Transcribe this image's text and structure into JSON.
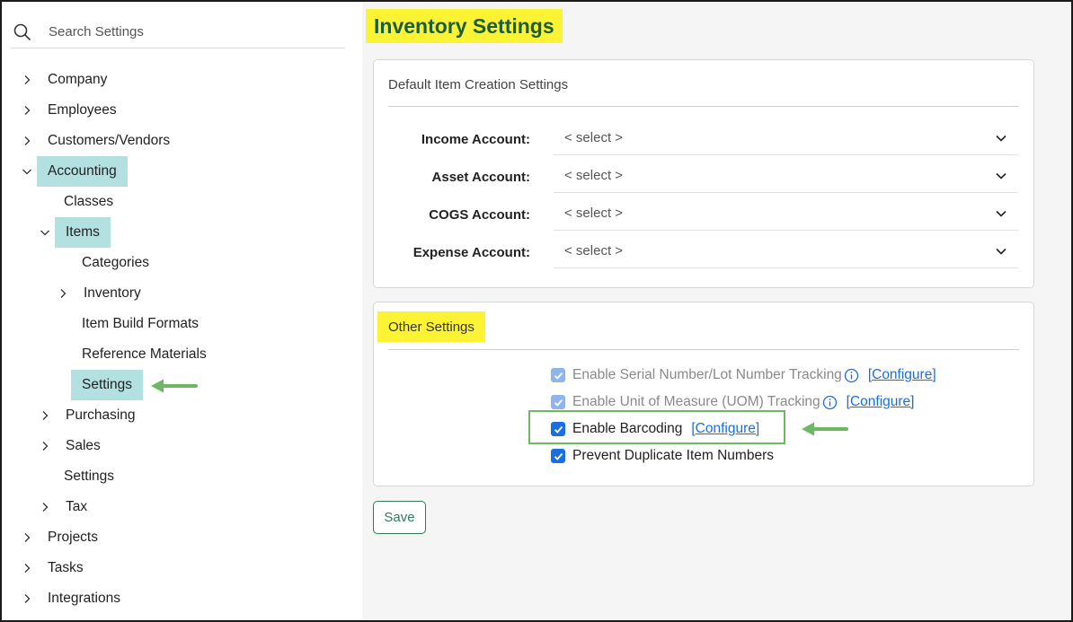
{
  "sidebar": {
    "search": {
      "placeholder": "Search Settings",
      "value": ""
    },
    "items": [
      {
        "label": "Company"
      },
      {
        "label": "Employees"
      },
      {
        "label": "Customers/Vendors"
      },
      {
        "label": "Accounting"
      },
      {
        "label": "Classes"
      },
      {
        "label": "Items"
      },
      {
        "label": "Categories"
      },
      {
        "label": "Inventory"
      },
      {
        "label": "Item Build Formats"
      },
      {
        "label": "Reference Materials"
      },
      {
        "label": "Settings"
      },
      {
        "label": "Purchasing"
      },
      {
        "label": "Sales"
      },
      {
        "label": "Settings"
      },
      {
        "label": "Tax"
      },
      {
        "label": "Projects"
      },
      {
        "label": "Tasks"
      },
      {
        "label": "Integrations"
      }
    ]
  },
  "main": {
    "title": "Inventory Settings",
    "default_section": {
      "title": "Default Item Creation Settings",
      "fields": [
        {
          "label": "Income Account:",
          "value": "< select >"
        },
        {
          "label": "Asset Account:",
          "value": "< select >"
        },
        {
          "label": "COGS Account:",
          "value": "< select >"
        },
        {
          "label": "Expense Account:",
          "value": "< select >"
        }
      ]
    },
    "other_section": {
      "title": "Other Settings",
      "options": [
        {
          "label": "Enable Serial Number/Lot Number Tracking",
          "link": "[Configure]",
          "checked": true,
          "disabled": true
        },
        {
          "label": "Enable Unit of Measure (UOM) Tracking",
          "link": "[Configure]",
          "checked": true,
          "disabled": true
        },
        {
          "label": "Enable Barcoding",
          "link": "[Configure]",
          "checked": true,
          "disabled": false
        },
        {
          "label": "Prevent Duplicate Item Numbers",
          "checked": true,
          "disabled": false
        }
      ]
    },
    "save_label": "Save"
  },
  "colors": {
    "accent": "#1a6fe0",
    "active_nav": "#b3e0e0",
    "highlight": "#fbf333",
    "title_text": "#1a5d3a",
    "annotation_green": "#6db863"
  }
}
